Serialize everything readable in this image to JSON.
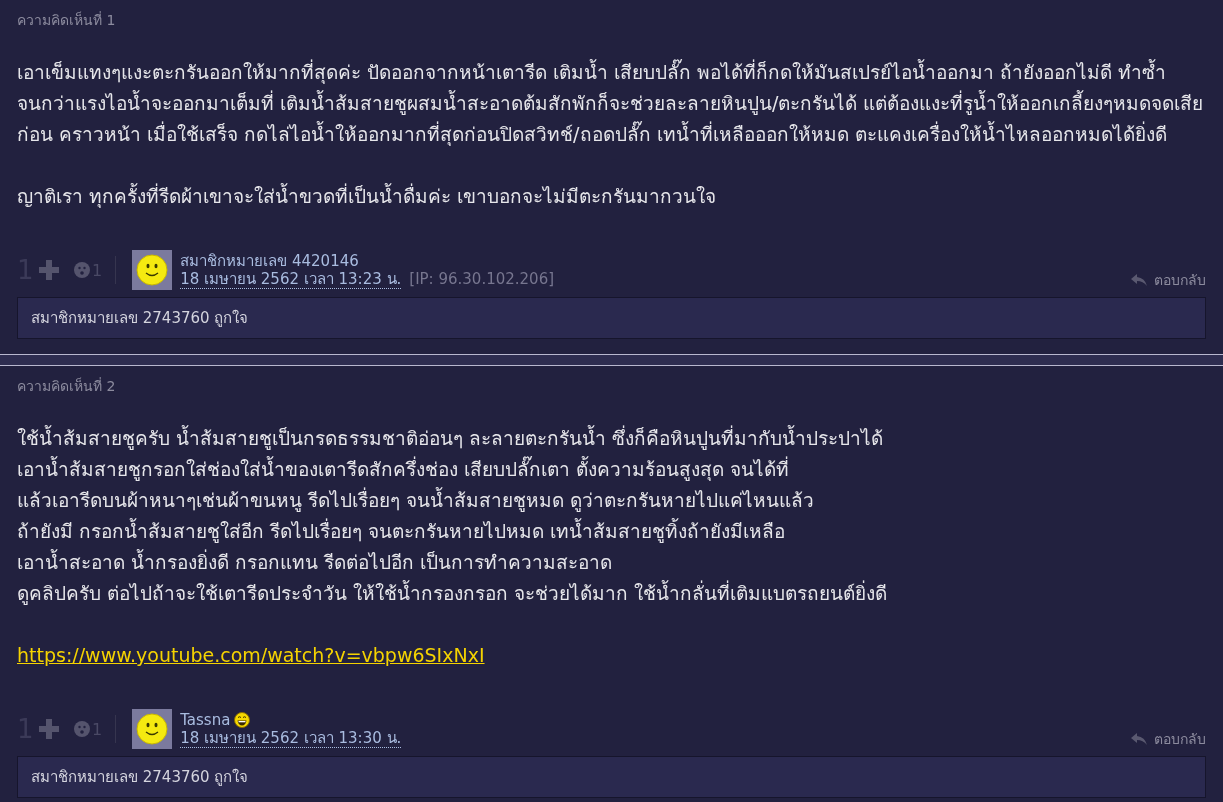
{
  "comments": [
    {
      "heading": "ความคิดเห็นที่ 1",
      "paragraphs": [
        {
          "lines": [
            "เอาเข็มแทงๆแงะตะกรันออกให้มากที่สุดค่ะ ปัดออกจากหน้าเตารีด เติมน้ำ เสียบปลั๊ก พอได้ที่ก็กดให้มันสเปรย์ไอน้ำออกมา ถ้ายังออกไม่ดี ทำซ้ำ",
            "จนกว่าแรงไอน้ำจะออกมาเต็มที่   เติมน้ำส้มสายชูผสมน้ำสะอาดต้มสักพักก็จะช่วยละลายหินปูน/ตะกรันได้ แต่ต้องแงะที่รูน้ำให้ออกเกลี้ยงๆหมดจดเสีย",
            "ก่อน คราวหน้า เมื่อใช้เสร็จ กดไล่ไอน้ำให้ออกมากที่สุดก่อนปิดสวิทช์/ถอดปลั๊ก   เทน้ำที่เหลือออกให้หมด ตะแคงเครื่องให้น้ำไหลออกหมดได้ยิ่งดี"
          ]
        },
        {
          "lines": [
            "ญาติเรา ทุกครั้งที่รีดผ้าเขาจะใส่น้ำขวดที่เป็นน้ำดื่มค่ะ เขาบอกจะไม่มีตะกรันมากวนใจ"
          ]
        }
      ],
      "votes": "1",
      "emotions": "1",
      "author": {
        "name": "สมาชิกหมายเลข 4420146",
        "date": "18 เมษายน 2562 เวลา 13:23 น.",
        "ip": "[IP: 96.30.102.206]"
      },
      "reply": "ตอบกลับ",
      "liked_by": "สมาชิกหมายเลข 2743760 ถูกใจ"
    },
    {
      "heading": "ความคิดเห็นที่ 2",
      "paragraphs": [
        {
          "lines": [
            "ใช้น้ำส้มสายชูครับ น้ำส้มสายชูเป็นกรดธรรมชาติอ่อนๆ ละลายตะกรันน้ำ ซึ่งก็คือหินปูนที่มากับน้ำประปาได้",
            "เอาน้ำส้มสายชูกรอกใส่ช่องใส่น้ำของเตารีดสักครึ่งช่อง เสียบปลั๊กเตา ตั้งความร้อนสูงสุด จนได้ที่",
            "แล้วเอารีดบนผ้าหนาๆเช่นผ้าขนหนู รีดไปเรื่อยๆ จนน้ำส้มสายชูหมด ดูว่าตะกรันหายไปแค่ไหนแล้ว",
            "ถ้ายังมี กรอกน้ำส้มสายชูใส่อีก รีดไปเรื่อยๆ จนตะกรันหายไปหมด เทน้ำส้มสายชูทิ้งถ้ายังมีเหลือ",
            "เอาน้ำสะอาด น้ำกรองยิ่งดี กรอกแทน รีดต่อไปอีก เป็นการทำความสะอาด",
            "ดูคลิปครับ ต่อไปถ้าจะใช้เตารีดประจำวัน ให้ใช้น้ำกรองกรอก จะช่วยได้มาก ใช้น้ำกลั่นที่เติมแบตรถยนต์ยิ่งดี"
          ]
        }
      ],
      "link": "https://www.youtube.com/watch?v=vbpw6SIxNxI",
      "votes": "1",
      "emotions": "1",
      "author": {
        "name": "Tassna",
        "emoticon": true,
        "date": "18 เมษายน 2562 เวลา 13:30 น."
      },
      "reply": "ตอบกลับ",
      "liked_by": "สมาชิกหมายเลข 2743760 ถูกใจ"
    }
  ]
}
